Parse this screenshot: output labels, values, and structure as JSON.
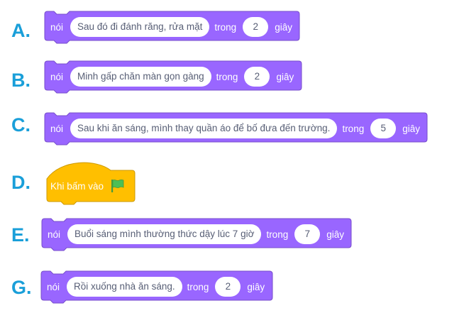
{
  "options": [
    {
      "letter": "A.",
      "keyword": "nói",
      "message": "Sau đó đi đánh răng, rửa mặt",
      "mid": "trong",
      "seconds": "2",
      "unit": "giây"
    },
    {
      "letter": "B.",
      "keyword": "nói",
      "message": "Minh gấp chăn màn gọn gàng",
      "mid": "trong",
      "seconds": "2",
      "unit": "giây"
    },
    {
      "letter": "C.",
      "keyword": "nói",
      "message": "Sau khi ăn sáng, mình thay quần áo để bố đưa đến trường.",
      "mid": "trong",
      "seconds": "5",
      "unit": "giây"
    },
    {
      "letter": "D.",
      "hat_label": "Khi bấm vào",
      "icon": "green-flag-icon"
    },
    {
      "letter": "E.",
      "keyword": "nói",
      "message": "Buổi sáng mình thường thức dậy lúc 7 giờ",
      "mid": "trong",
      "seconds": "7",
      "unit": "giây"
    },
    {
      "letter": "G.",
      "keyword": "nói",
      "message": "Rồi xuống nhà ăn sáng.",
      "mid": "trong",
      "seconds": "2",
      "unit": "giây"
    }
  ],
  "colors": {
    "looks_block": "#9966ff",
    "looks_border": "#774dcb",
    "events_block": "#ffbf00",
    "events_border": "#cc9900",
    "letter": "#1a9fd9",
    "flag": "#4cbf56"
  }
}
